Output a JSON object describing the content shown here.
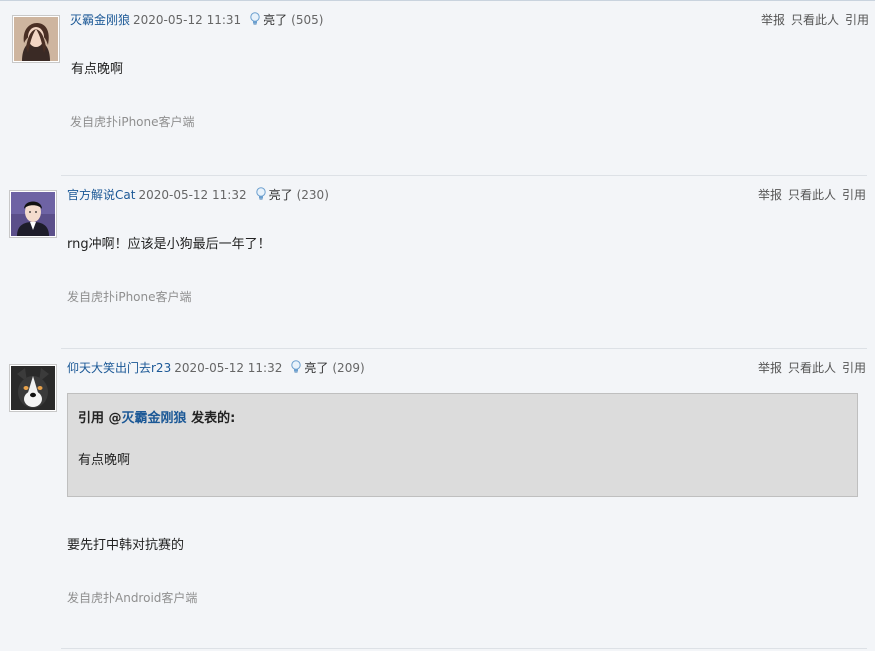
{
  "posts": [
    {
      "username": "灭霸金刚狼",
      "time": "2020-05-12 11:31",
      "light_label": "亮了",
      "light_count": "(505)",
      "actions": [
        "举报",
        "只看此人",
        "引用"
      ],
      "content": "有点晚啊",
      "from": "发自虎扑iPhone客户端",
      "avatar_icon": "user-avatar-woman"
    },
    {
      "username": "官方解说Cat",
      "time": "2020-05-12 11:32",
      "light_label": "亮了",
      "light_count": "(230)",
      "actions": [
        "举报",
        "只看此人",
        "引用"
      ],
      "content": "rng冲啊！应该是小狗最后一年了！",
      "from": "发自虎扑iPhone客户端",
      "avatar_icon": "user-avatar-man"
    },
    {
      "username": "仰天大笑出门去r23",
      "time": "2020-05-12 11:32",
      "light_label": "亮了",
      "light_count": "(209)",
      "actions": [
        "举报",
        "只看此人",
        "引用"
      ],
      "quote": {
        "prefix": "引用 @",
        "user": "灭霸金刚狼",
        "suffix": " 发表的:",
        "content": "有点晚啊"
      },
      "content": "要先打中韩对抗赛的",
      "from": "发自虎扑Android客户端",
      "avatar_icon": "user-avatar-dog"
    }
  ],
  "colors": {
    "background": "#f3f5f8",
    "username": "#1b5896",
    "quote_bg": "#dcdcdc"
  }
}
